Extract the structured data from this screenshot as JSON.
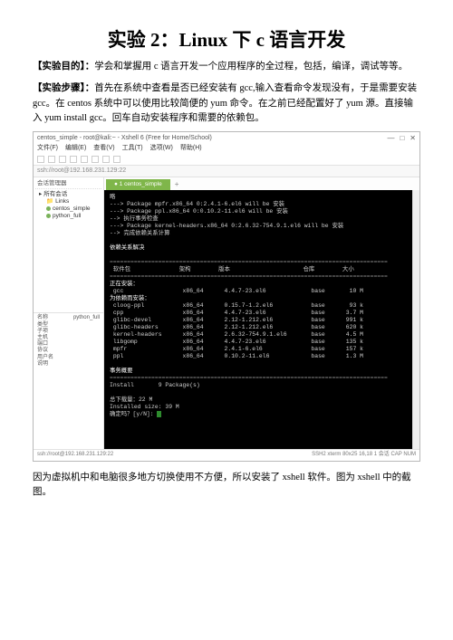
{
  "doc": {
    "title": "实验 2：Linux 下 c 语言开发",
    "objective_label": "【实验目的】：",
    "objective_text": "学会和掌握用 c 语言开发一个应用程序的全过程，包括，编译，调试等等。",
    "steps_label": "【实验步骤】：",
    "steps_text": "首先在系统中查看是否已经安装有 gcc,输入查看命令发现没有，于是需要安装 gcc。在 centos 系统中可以使用比较简便的 yum 命令。在之前已经配置好了 yum 源。直接输入  yum install gcc。回车自动安装程序和需要的依赖包。",
    "footer": "因为虚拟机中和电脑很多地方切换使用不方便，所以安装了 xshell 软件。图为 xshell 中的截图。"
  },
  "app": {
    "title": "centos_simple - root@kali:~ - Xshell 6 (Free for Home/School)",
    "menu": [
      "文件(F)",
      "编辑(E)",
      "查看(V)",
      "工具(T)",
      "选项(W)",
      "帮助(H)"
    ],
    "address": "ssh://root@192.168.231.129:22",
    "sidebar": {
      "header": "会话管理器",
      "items": [
        "所有会话",
        "Links",
        "centos_simple",
        "python_full"
      ]
    },
    "props": {
      "name_label": "名称",
      "name_val": "python_full",
      "type": "类型",
      "sub": "子项",
      "host": "主机",
      "port": "端口",
      "proto": "协议",
      "user": "用户名",
      "desc": "说明"
    },
    "tabs": {
      "active": "1 centos_simple",
      "plus": "+"
    },
    "status_left": "ssh://root@192.168.231.129:22",
    "status_right": "SSH2   xterm   80x25   16,18   1 会话   CAP NUM"
  },
  "term": {
    "l01": "略",
    "l02": "---> Package mpfr.x86_64 0:2.4.1-6.el6 will be 安装",
    "l03": "---> Package ppl.x86_64 0:0.10.2-11.el6 will be 安装",
    "l04": "--> 执行事务检查",
    "l05": "---> Package kernel-headers.x86_64 0:2.6.32-754.9.1.el6 will be 安装",
    "l06": "--> 完成依赖关系计算",
    "l07": "依赖关系解决",
    "hdr": " 软件包              架构        版本                     仓库        大小",
    "sec1": "正在安装：",
    "r01": " gcc                 x86_64      4.4.7-23.el6             base       10 M",
    "sec2": "为依赖而安装：",
    "r02": " cloog-ppl           x86_64      0.15.7-1.2.el6           base       93 k",
    "r03": " cpp                 x86_64      4.4.7-23.el6             base      3.7 M",
    "r04": " glibc-devel         x86_64      2.12-1.212.el6           base      991 k",
    "r05": " glibc-headers       x86_64      2.12-1.212.el6           base      620 k",
    "r06": " kernel-headers      x86_64      2.6.32-754.9.1.el6       base      4.5 M",
    "r07": " libgomp             x86_64      4.4.7-23.el6             base      135 k",
    "r08": " mpfr                x86_64      2.4.1-6.el6              base      157 k",
    "r09": " ppl                 x86_64      0.10.2-11.el6            base      1.3 M",
    "sum_h": "事务概要",
    "sum1": "Install       9 Package(s)",
    "sum2": "总下载量：22 M",
    "sum3": "Installed size: 39 M",
    "prompt": "确定吗？[y/N]: "
  }
}
